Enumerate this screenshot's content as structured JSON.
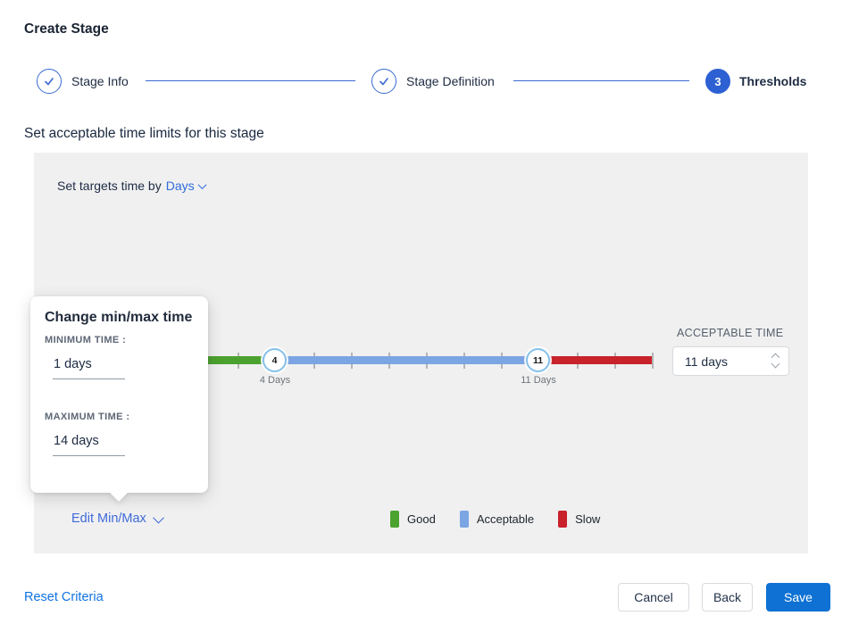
{
  "page": {
    "title": "Create Stage"
  },
  "stepper": {
    "steps": [
      {
        "label": "Stage Info",
        "state": "complete"
      },
      {
        "label": "Stage Definition",
        "state": "complete"
      },
      {
        "label": "Thresholds",
        "state": "active",
        "number": "3"
      }
    ]
  },
  "section": {
    "heading": "Set acceptable time limits for this stage"
  },
  "panel": {
    "targets_label": "Set targets time by",
    "targets_value": "Days",
    "slider": {
      "min_handle_value": "4",
      "min_handle_label": "4 Days",
      "max_handle_value": "11",
      "max_handle_label": "11 Days",
      "range_min_days": 1,
      "range_max_days": 14
    },
    "acceptable_time": {
      "label": "ACCEPTABLE TIME",
      "value": "11 days"
    },
    "edit_minmax_label": "Edit Min/Max",
    "legend": [
      {
        "label": "Good",
        "color": "#4ba22e"
      },
      {
        "label": "Acceptable",
        "color": "#7ba5e3"
      },
      {
        "label": "Slow",
        "color": "#c8222a"
      }
    ]
  },
  "popup": {
    "title": "Change min/max time",
    "min_label": "MINIMUM TIME :",
    "min_value": "1 days",
    "max_label": "MAXIMUM TIME :",
    "max_value": "14 days"
  },
  "footer": {
    "reset_label": "Reset Criteria",
    "cancel_label": "Cancel",
    "back_label": "Back",
    "save_label": "Save"
  },
  "colors": {
    "accent_blue": "#3a6ad4",
    "step_filled": "#2d60d2",
    "link_blue": "#1173e2",
    "save_blue": "#0e71d3",
    "panel_bg": "#f0f0f1",
    "good": "#4ba22e",
    "acceptable": "#7ba5e3",
    "slow": "#c8222a"
  }
}
